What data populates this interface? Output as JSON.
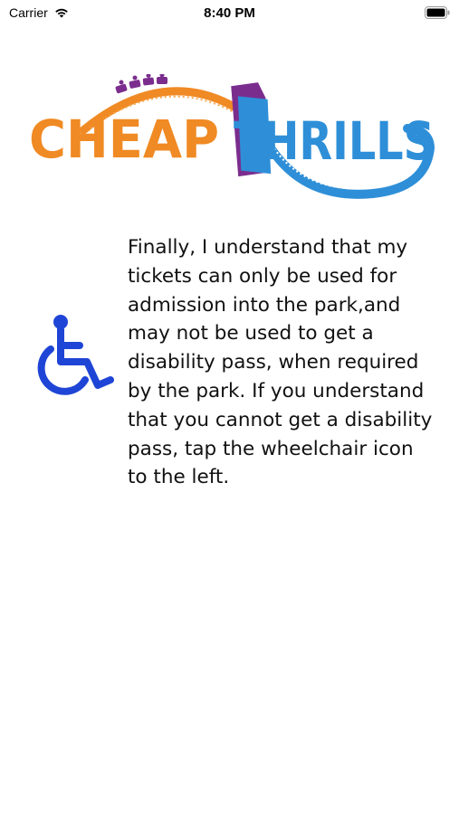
{
  "status_bar": {
    "carrier": "Carrier",
    "time": "8:40 PM",
    "icons": [
      "wifi-icon",
      "battery-icon"
    ]
  },
  "logo": {
    "text_left": "CHEAP",
    "text_right": "THRILLS",
    "colors": {
      "orange": "#F08A24",
      "blue": "#2E8FD8",
      "purple": "#7B2D8E"
    }
  },
  "main": {
    "message": "Finally, I understand that my\ntickets can only be used for\nadmission into the park,and\nmay not be used to get a\ndisability pass, when required\nby the park. If you understand\nthat you cannot get a disability\npass, tap the wheelchair icon\nto the left.",
    "wheelchair_icon": "wheelchair-icon",
    "wheelchair_color": "#1F45D6"
  }
}
